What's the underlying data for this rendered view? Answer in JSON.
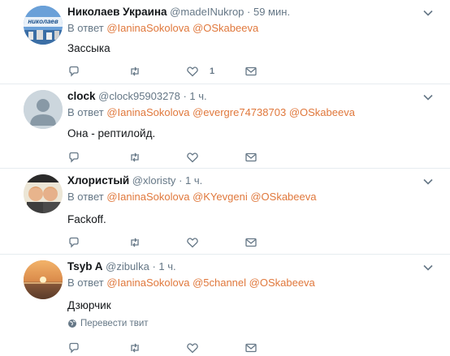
{
  "tweets": [
    {
      "name": "Николаев Украина",
      "handle": "@madeINukrop",
      "time": "· 59 мин.",
      "reply_prefix": "В ответ",
      "mentions": [
        "@IaninaSokolova",
        "@OSkabeeva"
      ],
      "text": "Зассыка",
      "likes": "1",
      "avatar_label": "николаев"
    },
    {
      "name": "clock",
      "handle": "@clock95903278",
      "time": "· 1 ч.",
      "reply_prefix": "В ответ",
      "mentions": [
        "@IaninaSokolova",
        "@evergre74738703",
        "@OSkabeeva"
      ],
      "text": "Она - рептилойд.",
      "likes": ""
    },
    {
      "name": "Хлористый",
      "handle": "@xloristy",
      "time": "· 1 ч.",
      "reply_prefix": "В ответ",
      "mentions": [
        "@IaninaSokolova",
        "@KYevgeni",
        "@OSkabeeva"
      ],
      "text": "Fackoff.",
      "likes": ""
    },
    {
      "name": "Tsyb A",
      "handle": "@zibulka",
      "time": "· 1 ч.",
      "reply_prefix": "В ответ",
      "mentions": [
        "@IaninaSokolova",
        "@5channel",
        "@OSkabeeva"
      ],
      "text": "Дзюрчик",
      "translate": "Перевести твит",
      "likes": ""
    }
  ],
  "colors": {
    "mention": "#e0783c",
    "secondary": "#657786",
    "divider": "#e6ecf0"
  },
  "icons": [
    "reply-icon",
    "retweet-icon",
    "like-icon",
    "dm-icon",
    "caret-down-icon",
    "globe-icon"
  ]
}
